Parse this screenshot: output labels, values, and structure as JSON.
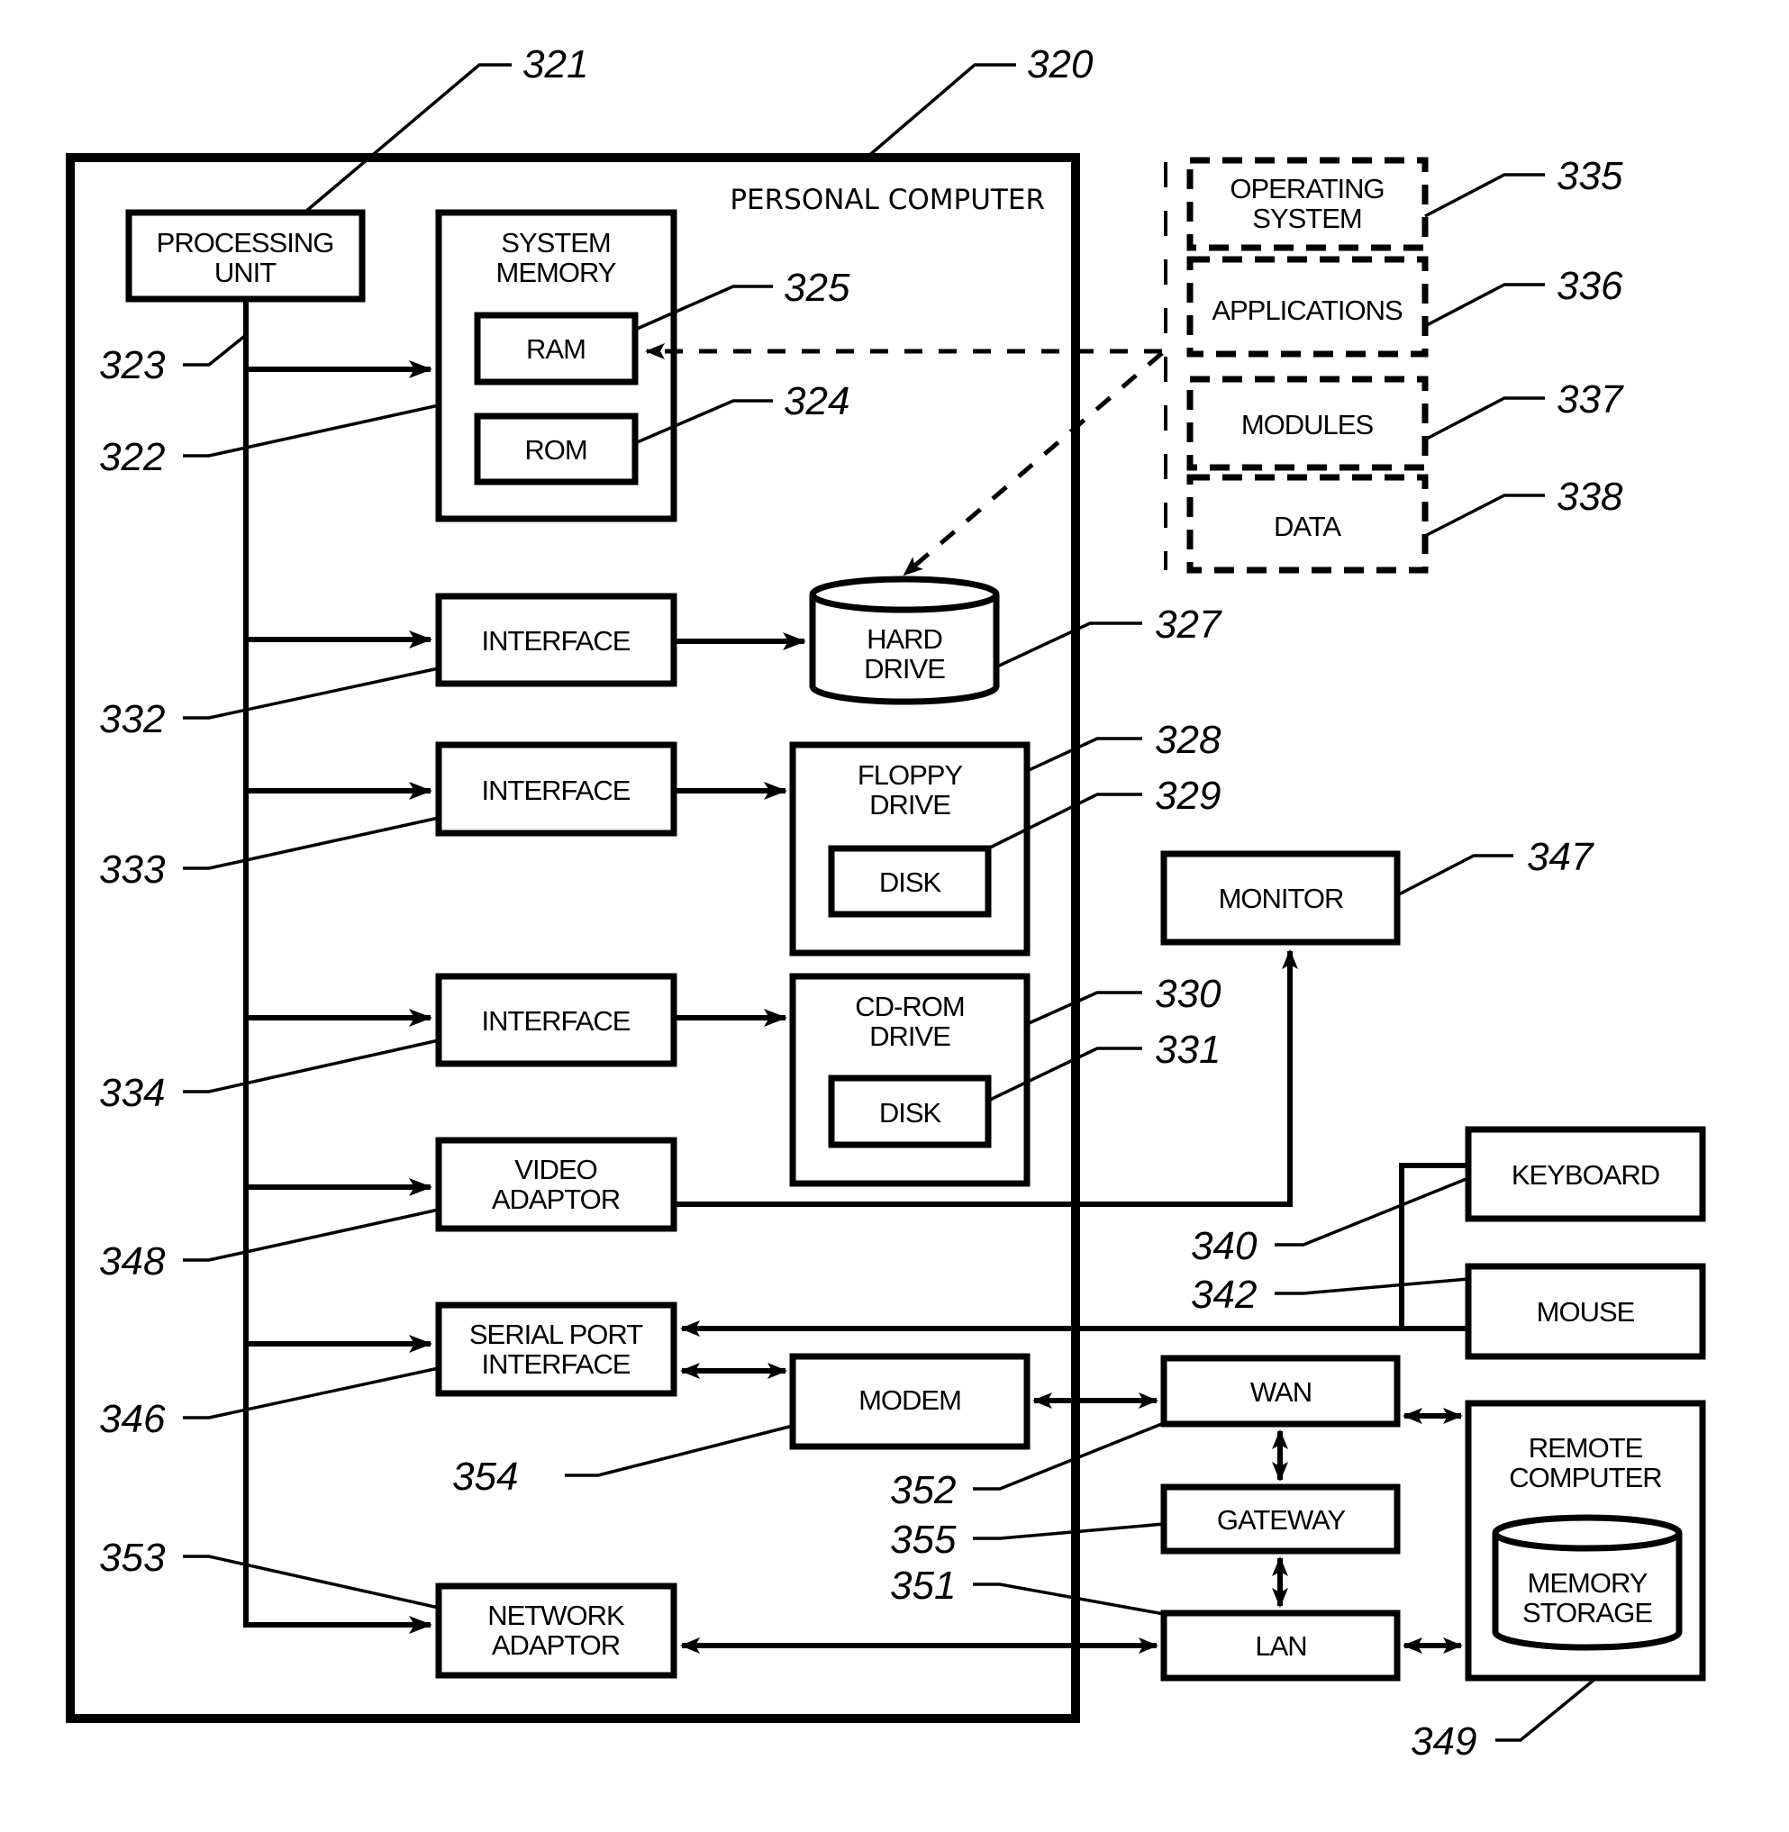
{
  "figure": {
    "container_label": "PERSONAL COMPUTER",
    "components": {
      "processing_unit": {
        "lines": [
          "PROCESSING",
          "UNIT"
        ],
        "ref": "321"
      },
      "system_memory": {
        "lines": [
          "SYSTEM",
          "MEMORY"
        ],
        "ref": "322"
      },
      "ram": {
        "lines": [
          "RAM"
        ],
        "ref": "325"
      },
      "rom": {
        "lines": [
          "ROM"
        ],
        "ref": "324"
      },
      "bus": {
        "ref": "323"
      },
      "interface_hd": {
        "lines": [
          "INTERFACE"
        ],
        "ref": "332"
      },
      "hard_drive": {
        "lines": [
          "HARD",
          "DRIVE"
        ],
        "ref": "327"
      },
      "interface_floppy": {
        "lines": [
          "INTERFACE"
        ],
        "ref": "333"
      },
      "floppy_drive": {
        "lines": [
          "FLOPPY",
          "DRIVE"
        ],
        "ref": "328"
      },
      "floppy_disk": {
        "lines": [
          "DISK"
        ],
        "ref": "329"
      },
      "interface_cdrom": {
        "lines": [
          "INTERFACE"
        ],
        "ref": "334"
      },
      "cdrom_drive": {
        "lines": [
          "CD-ROM",
          "DRIVE"
        ],
        "ref": "330"
      },
      "cdrom_disk": {
        "lines": [
          "DISK"
        ],
        "ref": "331"
      },
      "video_adaptor": {
        "lines": [
          "VIDEO",
          "ADAPTOR"
        ],
        "ref": "348"
      },
      "serial_port": {
        "lines": [
          "SERIAL PORT",
          "INTERFACE"
        ],
        "ref": "346"
      },
      "modem": {
        "lines": [
          "MODEM"
        ],
        "ref": "354"
      },
      "network_adaptor": {
        "lines": [
          "NETWORK",
          "ADAPTOR"
        ],
        "ref": "353"
      },
      "operating_system": {
        "lines": [
          "OPERATING",
          "SYSTEM"
        ],
        "ref": "335"
      },
      "applications": {
        "lines": [
          "APPLICATIONS"
        ],
        "ref": "336"
      },
      "modules": {
        "lines": [
          "MODULES"
        ],
        "ref": "337"
      },
      "data": {
        "lines": [
          "DATA"
        ],
        "ref": "338"
      },
      "monitor": {
        "lines": [
          "MONITOR"
        ],
        "ref": "347"
      },
      "keyboard": {
        "lines": [
          "KEYBOARD"
        ],
        "ref": "340"
      },
      "mouse": {
        "lines": [
          "MOUSE"
        ],
        "ref": "342"
      },
      "wan": {
        "lines": [
          "WAN"
        ],
        "ref": "352"
      },
      "gateway": {
        "lines": [
          "GATEWAY"
        ],
        "ref": "355"
      },
      "lan": {
        "lines": [
          "LAN"
        ],
        "ref": "351"
      },
      "remote_computer": {
        "lines": [
          "REMOTE",
          "COMPUTER"
        ],
        "ref": "349"
      },
      "memory_storage": {
        "lines": [
          "MEMORY",
          "STORAGE"
        ]
      }
    },
    "container_ref": "320"
  }
}
